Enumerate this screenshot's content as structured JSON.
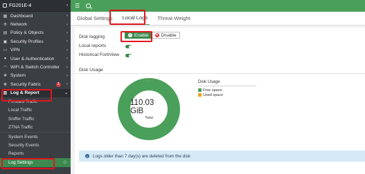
{
  "device": {
    "name": "FG201E-4"
  },
  "nav": [
    {
      "label": "Dashboard",
      "icon": "dashboard-icon",
      "glyph": "▦",
      "chevron": "›"
    },
    {
      "label": "Network",
      "icon": "network-icon",
      "glyph": "✣",
      "chevron": "›"
    },
    {
      "label": "Policy & Objects",
      "icon": "policy-icon",
      "glyph": "▤",
      "chevron": "›"
    },
    {
      "label": "Security Profiles",
      "icon": "lock-icon",
      "glyph": "▣",
      "chevron": "›"
    },
    {
      "label": "VPN",
      "icon": "vpn-icon",
      "glyph": "▭",
      "chevron": "›"
    },
    {
      "label": "User & Authentication",
      "icon": "user-icon",
      "glyph": "●",
      "chevron": "›"
    },
    {
      "label": "WiFi & Switch Controller",
      "icon": "wifi-icon",
      "glyph": "◠",
      "chevron": "›"
    },
    {
      "label": "System",
      "icon": "gear-icon",
      "glyph": "✻",
      "chevron": "›"
    },
    {
      "label": "Security Fabric",
      "icon": "fabric-icon",
      "glyph": "✥",
      "chevron": "›",
      "badge": "1"
    },
    {
      "label": "Log & Report",
      "icon": "chart-icon",
      "glyph": "▥",
      "chevron": "⌄",
      "active": true
    }
  ],
  "sub_nav": [
    "Forward Traffic",
    "Local Traffic",
    "Sniffer Traffic",
    "ZTNA Traffic",
    "System Events",
    "Security Events",
    "Reports",
    "Log Settings"
  ],
  "tabs": [
    "Global Settings",
    "Local Logs",
    "Threat Weight"
  ],
  "settings": {
    "disk_logging_label": "Disk logging",
    "enable_label": "Enable",
    "disable_label": "Disable",
    "local_reports_label": "Local reports",
    "historical_label": "Historical FortiView"
  },
  "usage": {
    "title": "Disk Usage",
    "center_value": "110.03 GiB",
    "center_label": "Total"
  },
  "chart_data": {
    "type": "pie",
    "title": "Disk Usage",
    "categories": [
      "Free space",
      "Used space"
    ],
    "values": [
      99.9,
      0.1
    ],
    "colors": [
      "#4a9f5b",
      "#e8a320"
    ],
    "legend_position": "right"
  },
  "info": {
    "text": "Logs older than 7 day(s) are deleted from the disk"
  },
  "colors": {
    "accent": "#4a9f5b",
    "highlight": "#e2141c",
    "sidebar": "#3a3f44"
  }
}
